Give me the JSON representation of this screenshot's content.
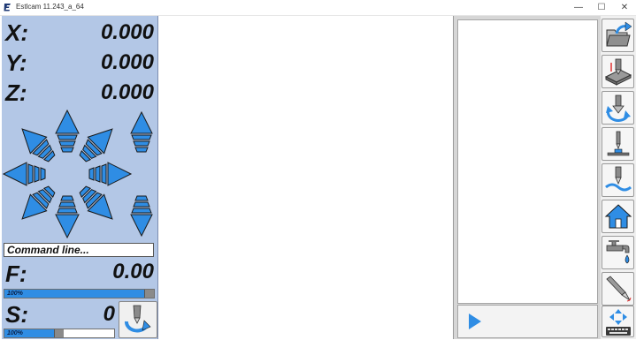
{
  "window": {
    "title": "Estlcam 11.243_a_64",
    "minimize": "—",
    "maximize": "☐",
    "close": "✕"
  },
  "coords": {
    "x": {
      "label": "X:",
      "value": "0.000"
    },
    "y": {
      "label": "Y:",
      "value": "0.000"
    },
    "z": {
      "label": "Z:",
      "value": "0.000"
    }
  },
  "jog": {
    "directions": [
      "up",
      "down",
      "left",
      "right",
      "up-left",
      "up-right",
      "down-left",
      "down-right",
      "z-up",
      "z-down"
    ]
  },
  "command_line": {
    "placeholder": "Command line..."
  },
  "feed": {
    "label": "F:",
    "value": "0.00",
    "override_text": "100%",
    "override_percent": 100
  },
  "spindle": {
    "label": "S:",
    "value": "0",
    "override_text": "100%",
    "override_percent": 100
  },
  "toolbar_icons": [
    "open-file-icon",
    "probe-surface-icon",
    "tool-change-icon",
    "tool-length-sensor-icon",
    "surface-probe-icon",
    "home-icon",
    "coolant-icon",
    "laser-tool-icon",
    "jog-keyboard-icon"
  ],
  "colors": {
    "panel_bg": "#b3c7e6",
    "arrow_blue": "#2f8de4",
    "bar_fill": "#2f8de4",
    "play_blue": "#2f8de4"
  }
}
